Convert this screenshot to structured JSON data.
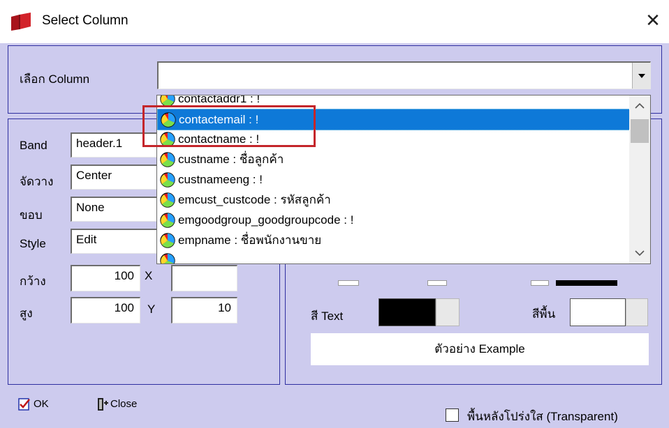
{
  "window": {
    "title": "Select Column",
    "close_icon": "close-icon"
  },
  "column_select": {
    "label": "เลือก Column",
    "value": ""
  },
  "dropdown": {
    "items": [
      "contactaddr1 : !",
      "contactemail : !",
      "contactname : !",
      "custname : ชื่อลูกค้า",
      "custnameeng : !",
      "emcust_custcode : รหัสลูกค้า",
      "emgoodgroup_goodgroupcode : !",
      "empname : ชื่อพนักงานขาย"
    ],
    "selected_index": 1
  },
  "props": {
    "band_label": "Band",
    "band_value": "header.1",
    "align_label": "จัดวาง",
    "align_value": "Center",
    "border_label": "ขอบ",
    "border_value": "None",
    "style_label": "Style",
    "style_value": "Edit",
    "width_label": "กว้าง",
    "width_value": "100",
    "x_label": "X",
    "height_label": "สูง",
    "height_value": "100",
    "y_label": "Y",
    "y_value": "10"
  },
  "colors": {
    "text_label": "สี Text",
    "text_color": "#000000",
    "bg_label": "สีพื้น",
    "bg_color": "#ffffff",
    "example": "ตัวอย่าง Example"
  },
  "buttons": {
    "ok": "OK",
    "close": "Close"
  },
  "transparent": {
    "label": "พื้นหลังโปร่งใส (Transparent)",
    "checked": false
  },
  "accent": {
    "selection": "#0e79d8",
    "dialog_bg": "#cdcbee",
    "highlight_box": "#c4262b"
  }
}
